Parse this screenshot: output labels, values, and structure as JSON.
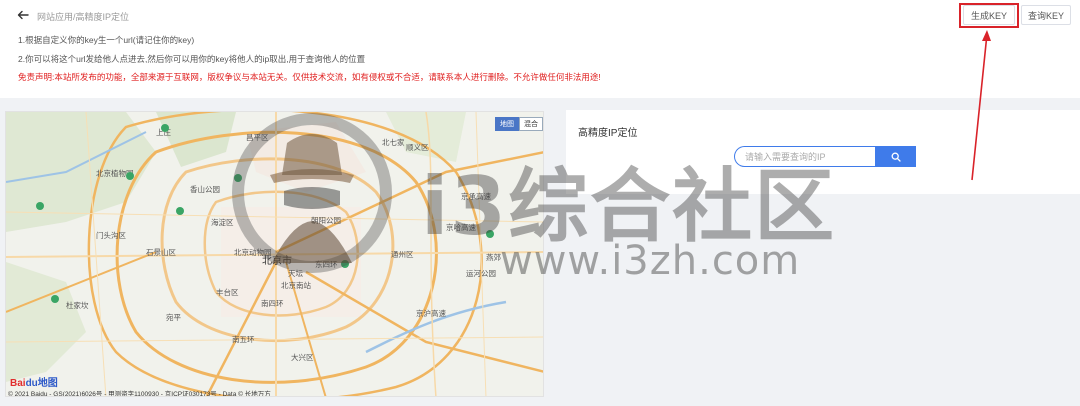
{
  "header": {
    "breadcrumb": "网站应用/高精度IP定位",
    "generate_key_label": "生成KEY",
    "query_key_label": "查询KEY"
  },
  "instructions": {
    "line1": "1.根据自定义你的key生一个url(请记住你的key)",
    "line2": "2.你可以将这个url发给他人点进去,然后你可以用你的key将他人的ip取出,用于查询他人的位置",
    "disclaimer": "免责声明:本站所发布的功能，全部来源于互联网，版权争议与本站无关。仅供技术交流，如有侵权或不合适，请联系本人进行删除。不允许做任何非法用途!"
  },
  "map": {
    "toggle_map": "地图",
    "toggle_satellite": "混合",
    "logo_text_a": "Bai",
    "logo_text_b": "du地图",
    "copyright": "© 2021 Baidu - GS(2021)6026号 - 甲测资字1100930 - 京ICP证030173号 - Data © 长地万方",
    "labels": {
      "beijing": "北京市",
      "dongsi": "东四环",
      "nansihuan": "南四环",
      "nanwuhuan": "南五环",
      "tongzhou": "通州区",
      "chaoyang": "朝阳公园",
      "beijing_zoo": "北京动物园",
      "xiangshan": "香山公园",
      "beijing_botanical": "北京植物园",
      "shijingshan": "石景山区",
      "fengtai": "丰台区",
      "daxing": "大兴区",
      "haidian": "海淀区",
      "changping": "昌平区",
      "shunyi": "顺义区",
      "mentougou": "门头沟区",
      "beijing_south": "北京南站",
      "tiantan": "天坛",
      "jingcheng": "京承高速",
      "jinghu": "京沪高速",
      "jingha": "京哈高速",
      "yanqi": "燕郊",
      "beiqijia": "北七家",
      "yunhe": "运河公园",
      "dujiakan": "杜家坎",
      "shangzhuang": "上庄",
      "wanping": "宛平"
    }
  },
  "panel": {
    "title": "高精度IP定位",
    "search_placeholder": "请输入需要查询的IP"
  },
  "watermark": {
    "name": "i3综合社区",
    "url": "www.i3zh.com"
  },
  "colors": {
    "accent": "#3f7bea",
    "highlight": "#d9232a",
    "disclaimer": "#e02020"
  }
}
